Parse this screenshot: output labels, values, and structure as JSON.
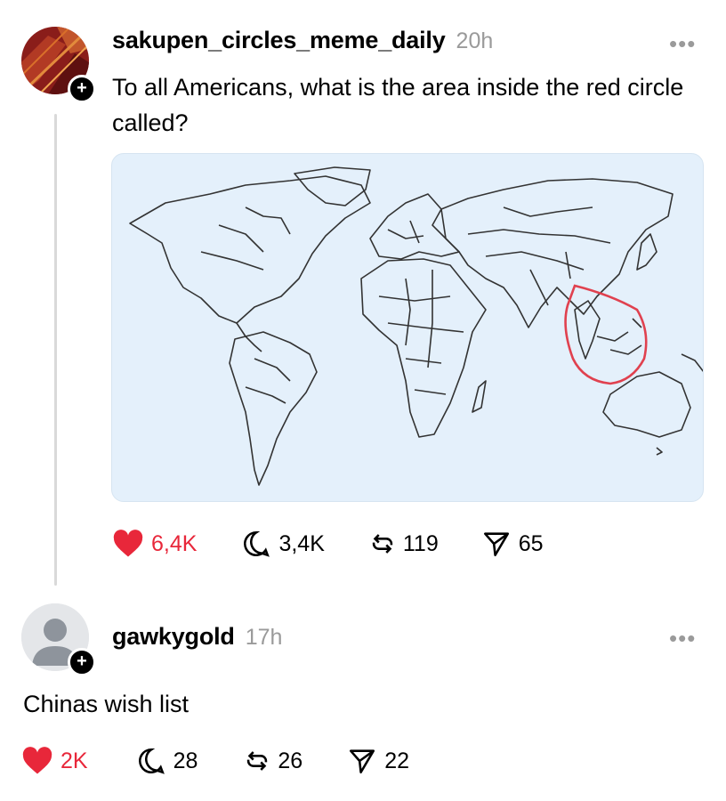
{
  "post": {
    "username": "sakupen_circles_meme_daily",
    "time": "20h",
    "more": "•••",
    "text": "To all Americans, what is the area inside the red circle called?",
    "likes": "6,4K",
    "comments": "3,4K",
    "reposts": "119",
    "shares": "65"
  },
  "reply": {
    "username": "gawkygold",
    "time": "17h",
    "more": "•••",
    "text": "Chinas wish list",
    "likes": "2K",
    "comments": "28",
    "reposts": "26",
    "shares": "22"
  },
  "colors": {
    "like_red": "#e8273a",
    "map_bg": "#e4f0fb",
    "circle_red": "#e0414f",
    "muted": "#9a9a9a"
  },
  "icons": [
    "heart-icon",
    "comment-icon",
    "repost-icon",
    "share-icon",
    "plus-icon",
    "more-icon"
  ]
}
